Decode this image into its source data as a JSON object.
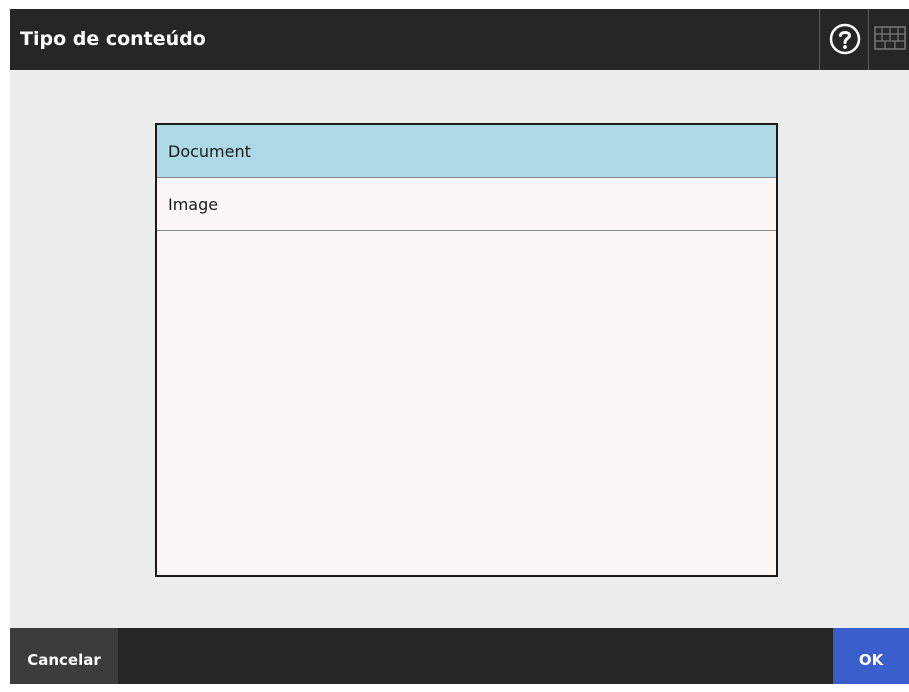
{
  "window": {
    "title": "Tipo de conteúdo"
  },
  "toolbar": {
    "help_icon": "help-question-icon",
    "keyboard_icon": "keyboard-icon"
  },
  "content_list": {
    "items": [
      {
        "label": "Document",
        "selected": true
      },
      {
        "label": "Image",
        "selected": false
      }
    ]
  },
  "footer": {
    "cancel_label": "Cancelar",
    "ok_label": "OK"
  },
  "colors": {
    "title_bar": "#262626",
    "background": "#ececec",
    "list_background": "#fcf7f6",
    "selected_item": "#add8e6",
    "ok_button": "#3a5fcd",
    "cancel_button": "#3c3c3c"
  }
}
